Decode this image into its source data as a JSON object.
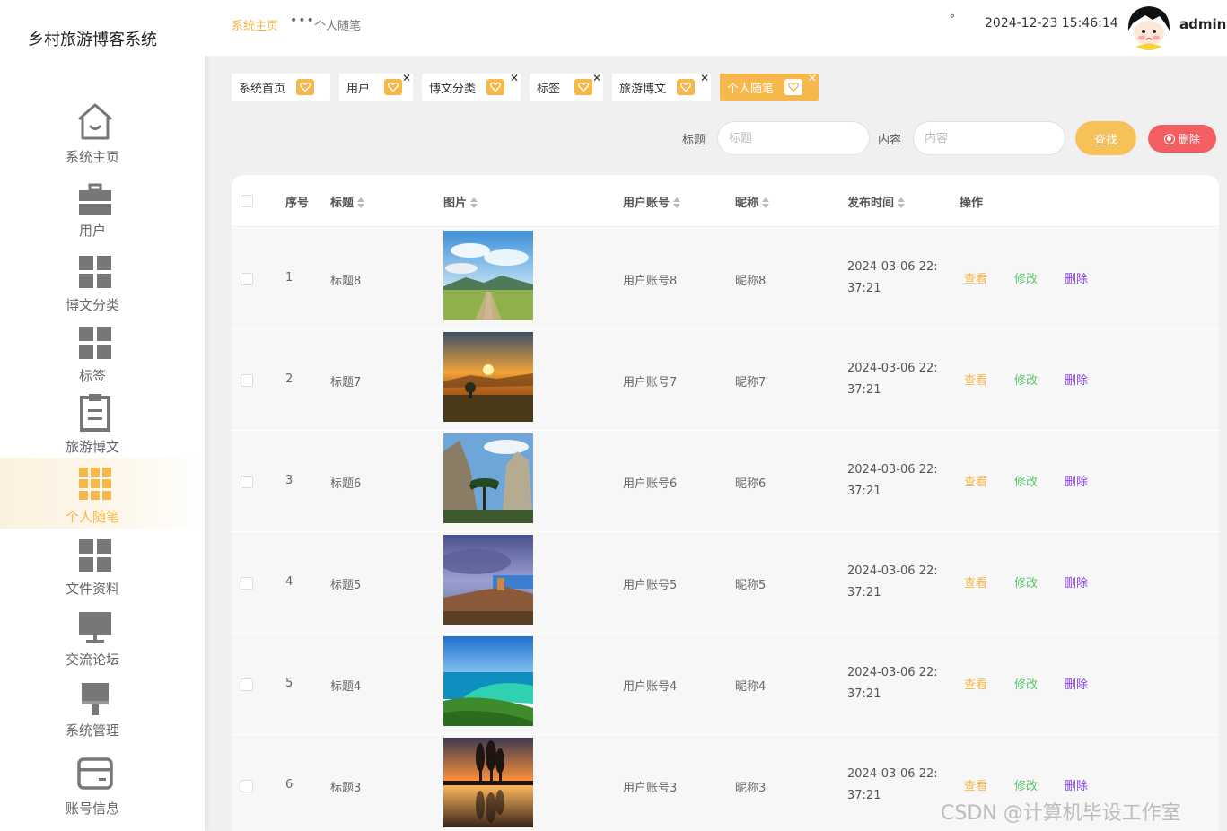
{
  "app": {
    "title": "乡村旅游博客系统"
  },
  "sidebar": {
    "items": [
      {
        "label": "系统主页",
        "icon": "home-icon"
      },
      {
        "label": "用户",
        "icon": "briefcase-icon"
      },
      {
        "label": "博文分类",
        "icon": "grid-icon"
      },
      {
        "label": "标签",
        "icon": "grid-icon"
      },
      {
        "label": "旅游博文",
        "icon": "clipboard-icon"
      },
      {
        "label": "个人随笔",
        "icon": "apps-icon",
        "active": true
      },
      {
        "label": "文件资料",
        "icon": "grid-icon"
      },
      {
        "label": "交流论坛",
        "icon": "monitor-icon"
      },
      {
        "label": "系统管理",
        "icon": "brush-icon"
      },
      {
        "label": "账号信息",
        "icon": "card-icon"
      }
    ]
  },
  "header": {
    "breadcrumb_home": "系统主页",
    "breadcrumb_dots": "•••",
    "breadcrumb_current": "个人随笔",
    "degree": "°",
    "datetime": "2024-12-23 15:46:14",
    "username": "admin"
  },
  "tabs": [
    {
      "label": "系统首页",
      "closable": false
    },
    {
      "label": "用户",
      "closable": true
    },
    {
      "label": "博文分类",
      "closable": true
    },
    {
      "label": "标签",
      "closable": true
    },
    {
      "label": "旅游博文",
      "closable": true
    },
    {
      "label": "个人随笔",
      "closable": true,
      "active": true
    }
  ],
  "search": {
    "title_label": "标题",
    "title_placeholder": "标题",
    "content_label": "内容",
    "content_placeholder": "内容",
    "search_button": "查找",
    "delete_button": "删除"
  },
  "table": {
    "columns": [
      "序号",
      "标题",
      "图片",
      "用户账号",
      "昵称",
      "发布时间",
      "操作"
    ],
    "actions": {
      "view": "查看",
      "edit": "修改",
      "delete": "删除"
    },
    "rows": [
      {
        "index": "1",
        "title": "标题8",
        "account": "用户账号8",
        "nickname": "昵称8",
        "time_line1": "2024-03-06 22:",
        "time_line2": "37:21"
      },
      {
        "index": "2",
        "title": "标题7",
        "account": "用户账号7",
        "nickname": "昵称7",
        "time_line1": "2024-03-06 22:",
        "time_line2": "37:21"
      },
      {
        "index": "3",
        "title": "标题6",
        "account": "用户账号6",
        "nickname": "昵称6",
        "time_line1": "2024-03-06 22:",
        "time_line2": "37:21"
      },
      {
        "index": "4",
        "title": "标题5",
        "account": "用户账号5",
        "nickname": "昵称5",
        "time_line1": "2024-03-06 22:",
        "time_line2": "37:21"
      },
      {
        "index": "5",
        "title": "标题4",
        "account": "用户账号4",
        "nickname": "昵称4",
        "time_line1": "2024-03-06 22:",
        "time_line2": "37:21"
      },
      {
        "index": "6",
        "title": "标题3",
        "account": "用户账号3",
        "nickname": "昵称3",
        "time_line1": "2024-03-06 22:",
        "time_line2": "37:21"
      }
    ]
  },
  "watermark": "CSDN @计算机毕设工作室",
  "colors": {
    "accent": "#f7b84b",
    "search_button": "#f7c15a",
    "delete_button": "#f35e63",
    "edit_action": "#5cc36b",
    "delete_action": "#8e44ef"
  }
}
